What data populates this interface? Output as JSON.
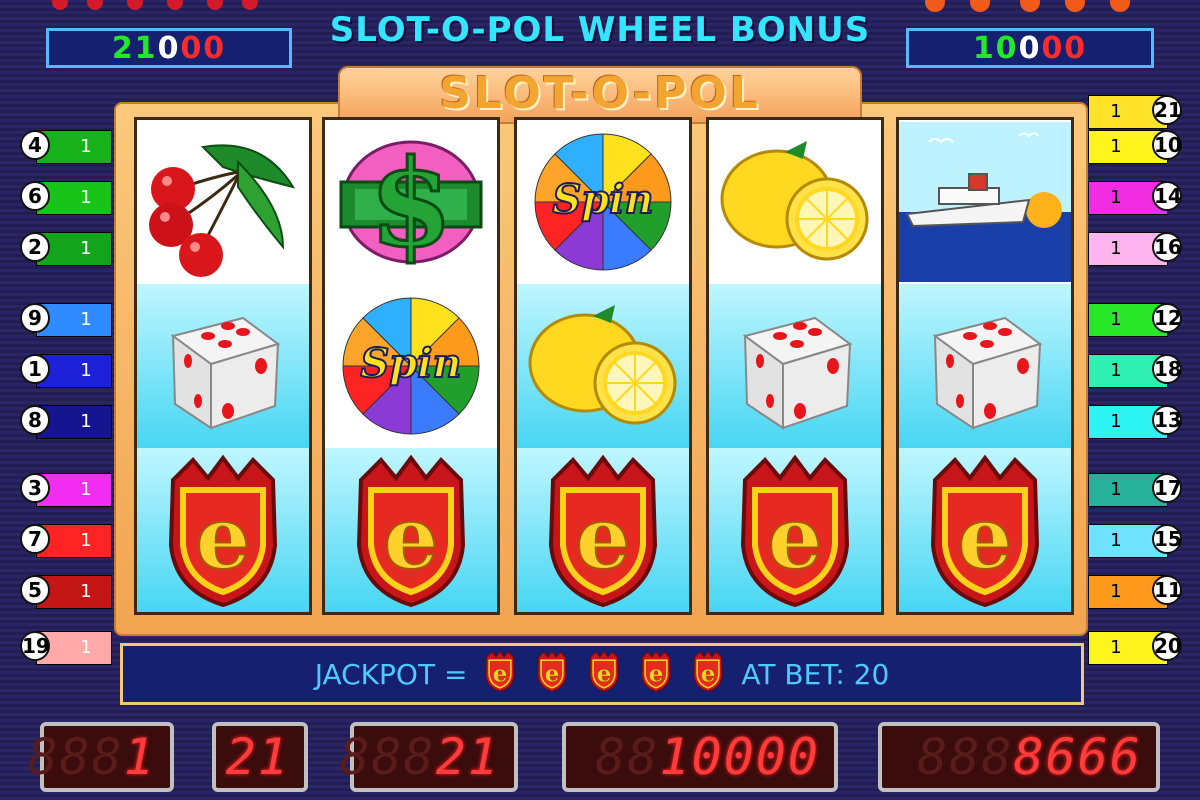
{
  "top_strip": {
    "left_icon": "cherry-row-icon",
    "right_icon": "e-shield-row-icon"
  },
  "bonus_title": "SLOT-O-POL  WHEEL BONUS",
  "left_pay": {
    "d1": "21",
    "d2": "0",
    "d3": "00"
  },
  "right_pay": {
    "d1": "10",
    "d2": "0",
    "d3": "00"
  },
  "logo": "SLOT-O-POL",
  "reels": [
    {
      "symbols": [
        "cherries-icon",
        "dice-icon",
        "e-shield-icon"
      ]
    },
    {
      "symbols": [
        "dollar-icon",
        "spin-wheel-icon",
        "e-shield-icon"
      ]
    },
    {
      "symbols": [
        "spin-wheel-icon",
        "lemon-icon",
        "e-shield-icon"
      ]
    },
    {
      "symbols": [
        "lemon-icon",
        "dice-icon",
        "e-shield-icon"
      ]
    },
    {
      "symbols": [
        "ship-icon",
        "dice-icon",
        "e-shield-icon"
      ]
    }
  ],
  "lines_left": [
    {
      "num": "4",
      "bet": "1",
      "color": "#17b21b"
    },
    {
      "num": "6",
      "bet": "1",
      "color": "#19c419"
    },
    {
      "num": "2",
      "bet": "1",
      "color": "#12a51b"
    },
    {
      "num": "9",
      "bet": "1",
      "color": "#2f8bff"
    },
    {
      "num": "1",
      "bet": "1",
      "color": "#1d22d8"
    },
    {
      "num": "8",
      "bet": "1",
      "color": "#15158f"
    },
    {
      "num": "3",
      "bet": "1",
      "color": "#f22cf2"
    },
    {
      "num": "7",
      "bet": "1",
      "color": "#ff2323"
    },
    {
      "num": "5",
      "bet": "1",
      "color": "#c51616"
    },
    {
      "num": "19",
      "bet": "1",
      "color": "#ffaaa8"
    }
  ],
  "lines_right": [
    {
      "num": "21",
      "bet": "1",
      "color": "#ffe32a"
    },
    {
      "num": "10",
      "bet": "1",
      "color": "#fff51d"
    },
    {
      "num": "14",
      "bet": "1",
      "color": "#f22ce2"
    },
    {
      "num": "16",
      "bet": "1",
      "color": "#ffb4f0"
    },
    {
      "num": "12",
      "bet": "1",
      "color": "#29e829"
    },
    {
      "num": "18",
      "bet": "1",
      "color": "#2ef0b0"
    },
    {
      "num": "13",
      "bet": "1",
      "color": "#2ff4f4"
    },
    {
      "num": "17",
      "bet": "1",
      "color": "#27b09a"
    },
    {
      "num": "15",
      "bet": "1",
      "color": "#6fe2ff"
    },
    {
      "num": "11",
      "bet": "1",
      "color": "#ff9a1c"
    },
    {
      "num": "20",
      "bet": "1",
      "color": "#fff51d"
    }
  ],
  "jackpot": {
    "label": "JACKPOT =",
    "icon_count": 5,
    "icon": "e-shield-icon",
    "bet_text": "AT BET: 20"
  },
  "counters": [
    {
      "name": "lines-counter",
      "ghost": "888",
      "value": "1"
    },
    {
      "name": "bet-per-line-counter",
      "ghost": "",
      "value": "21"
    },
    {
      "name": "total-bet-counter",
      "ghost": "888",
      "value": "21"
    },
    {
      "name": "credit-counter",
      "ghost": "88",
      "value": "10000"
    },
    {
      "name": "win-counter",
      "ghost": "888",
      "value": "8666"
    }
  ]
}
